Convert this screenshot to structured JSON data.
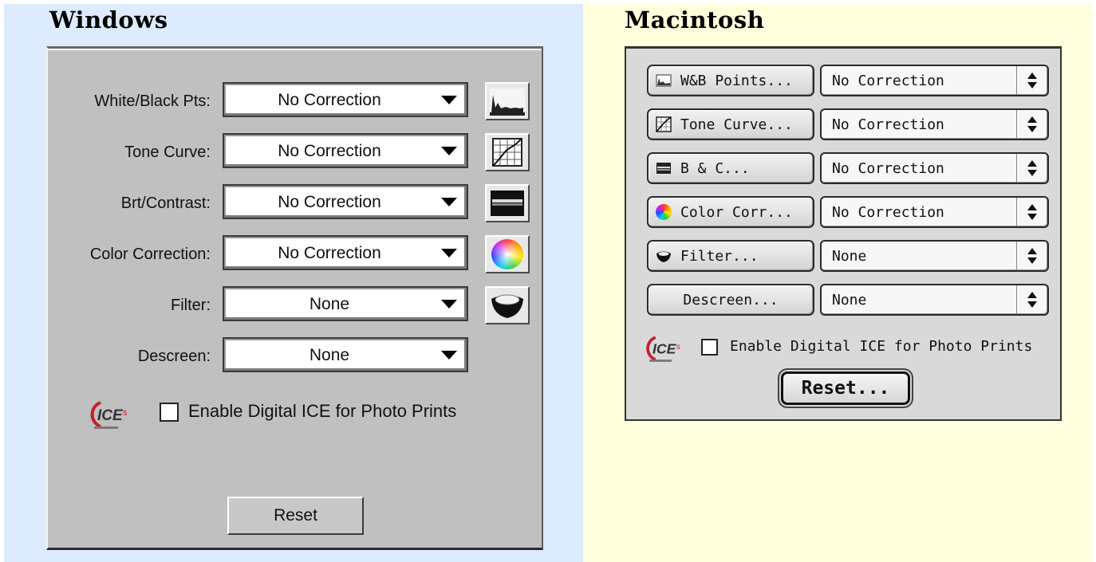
{
  "windows": {
    "heading": "Windows",
    "rows": [
      {
        "label": "White/Black Pts:",
        "value": "No Correction",
        "icon": "histogram-icon"
      },
      {
        "label": "Tone Curve:",
        "value": "No Correction",
        "icon": "tone-curve-icon"
      },
      {
        "label": "Brt/Contrast:",
        "value": "No Correction",
        "icon": "brightness-contrast-icon"
      },
      {
        "label": "Color Correction:",
        "value": "No Correction",
        "icon": "color-wheel-icon"
      },
      {
        "label": "Filter:",
        "value": "None",
        "icon": "filter-icon"
      },
      {
        "label": "Descreen:",
        "value": "None",
        "icon": ""
      }
    ],
    "ice_label": "Enable Digital ICE for Photo Prints",
    "ice_checked": false,
    "reset_label": "Reset"
  },
  "mac": {
    "heading": "Macintosh",
    "rows": [
      {
        "button": "W&B Points...",
        "value": "No Correction",
        "icon": "histogram-icon"
      },
      {
        "button": "Tone Curve...",
        "value": "No Correction",
        "icon": "tone-curve-icon"
      },
      {
        "button": "B & C...",
        "value": "No Correction",
        "icon": "brightness-contrast-icon"
      },
      {
        "button": "Color Corr...",
        "value": "No Correction",
        "icon": "color-wheel-icon"
      },
      {
        "button": "Filter...",
        "value": "None",
        "icon": "filter-icon"
      },
      {
        "button": "Descreen...",
        "value": "None",
        "icon": ""
      }
    ],
    "ice_label": "Enable Digital ICE for Photo Prints",
    "ice_checked": false,
    "reset_label": "Reset..."
  },
  "colors": {
    "windows_bg": "#dcebfd",
    "mac_bg": "#ffffdd",
    "dialog_gray": "#c0c0c0",
    "ice_red": "#c4202a"
  }
}
